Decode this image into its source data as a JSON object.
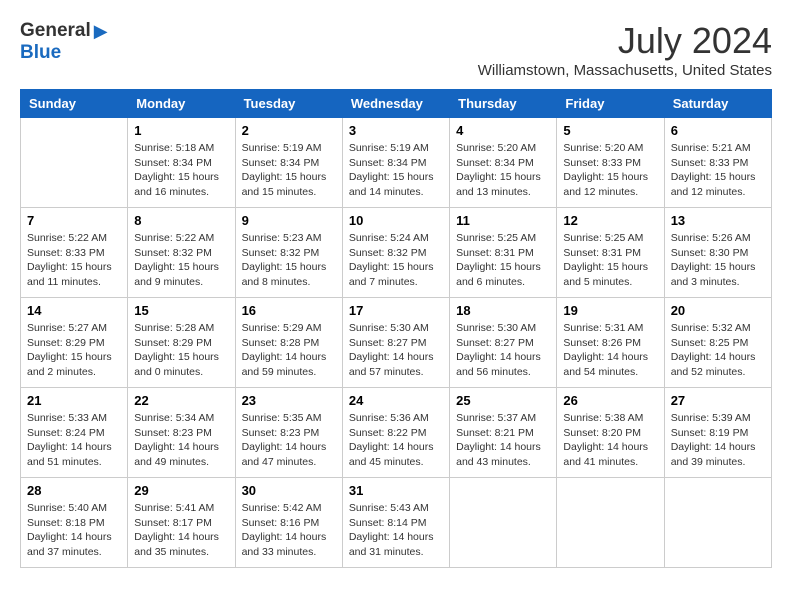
{
  "header": {
    "logo_general": "General",
    "logo_blue": "Blue",
    "month": "July 2024",
    "location": "Williamstown, Massachusetts, United States"
  },
  "days_of_week": [
    "Sunday",
    "Monday",
    "Tuesday",
    "Wednesday",
    "Thursday",
    "Friday",
    "Saturday"
  ],
  "weeks": [
    [
      {
        "day": "",
        "info": ""
      },
      {
        "day": "1",
        "info": "Sunrise: 5:18 AM\nSunset: 8:34 PM\nDaylight: 15 hours\nand 16 minutes."
      },
      {
        "day": "2",
        "info": "Sunrise: 5:19 AM\nSunset: 8:34 PM\nDaylight: 15 hours\nand 15 minutes."
      },
      {
        "day": "3",
        "info": "Sunrise: 5:19 AM\nSunset: 8:34 PM\nDaylight: 15 hours\nand 14 minutes."
      },
      {
        "day": "4",
        "info": "Sunrise: 5:20 AM\nSunset: 8:34 PM\nDaylight: 15 hours\nand 13 minutes."
      },
      {
        "day": "5",
        "info": "Sunrise: 5:20 AM\nSunset: 8:33 PM\nDaylight: 15 hours\nand 12 minutes."
      },
      {
        "day": "6",
        "info": "Sunrise: 5:21 AM\nSunset: 8:33 PM\nDaylight: 15 hours\nand 12 minutes."
      }
    ],
    [
      {
        "day": "7",
        "info": "Sunrise: 5:22 AM\nSunset: 8:33 PM\nDaylight: 15 hours\nand 11 minutes."
      },
      {
        "day": "8",
        "info": "Sunrise: 5:22 AM\nSunset: 8:32 PM\nDaylight: 15 hours\nand 9 minutes."
      },
      {
        "day": "9",
        "info": "Sunrise: 5:23 AM\nSunset: 8:32 PM\nDaylight: 15 hours\nand 8 minutes."
      },
      {
        "day": "10",
        "info": "Sunrise: 5:24 AM\nSunset: 8:32 PM\nDaylight: 15 hours\nand 7 minutes."
      },
      {
        "day": "11",
        "info": "Sunrise: 5:25 AM\nSunset: 8:31 PM\nDaylight: 15 hours\nand 6 minutes."
      },
      {
        "day": "12",
        "info": "Sunrise: 5:25 AM\nSunset: 8:31 PM\nDaylight: 15 hours\nand 5 minutes."
      },
      {
        "day": "13",
        "info": "Sunrise: 5:26 AM\nSunset: 8:30 PM\nDaylight: 15 hours\nand 3 minutes."
      }
    ],
    [
      {
        "day": "14",
        "info": "Sunrise: 5:27 AM\nSunset: 8:29 PM\nDaylight: 15 hours\nand 2 minutes."
      },
      {
        "day": "15",
        "info": "Sunrise: 5:28 AM\nSunset: 8:29 PM\nDaylight: 15 hours\nand 0 minutes."
      },
      {
        "day": "16",
        "info": "Sunrise: 5:29 AM\nSunset: 8:28 PM\nDaylight: 14 hours\nand 59 minutes."
      },
      {
        "day": "17",
        "info": "Sunrise: 5:30 AM\nSunset: 8:27 PM\nDaylight: 14 hours\nand 57 minutes."
      },
      {
        "day": "18",
        "info": "Sunrise: 5:30 AM\nSunset: 8:27 PM\nDaylight: 14 hours\nand 56 minutes."
      },
      {
        "day": "19",
        "info": "Sunrise: 5:31 AM\nSunset: 8:26 PM\nDaylight: 14 hours\nand 54 minutes."
      },
      {
        "day": "20",
        "info": "Sunrise: 5:32 AM\nSunset: 8:25 PM\nDaylight: 14 hours\nand 52 minutes."
      }
    ],
    [
      {
        "day": "21",
        "info": "Sunrise: 5:33 AM\nSunset: 8:24 PM\nDaylight: 14 hours\nand 51 minutes."
      },
      {
        "day": "22",
        "info": "Sunrise: 5:34 AM\nSunset: 8:23 PM\nDaylight: 14 hours\nand 49 minutes."
      },
      {
        "day": "23",
        "info": "Sunrise: 5:35 AM\nSunset: 8:23 PM\nDaylight: 14 hours\nand 47 minutes."
      },
      {
        "day": "24",
        "info": "Sunrise: 5:36 AM\nSunset: 8:22 PM\nDaylight: 14 hours\nand 45 minutes."
      },
      {
        "day": "25",
        "info": "Sunrise: 5:37 AM\nSunset: 8:21 PM\nDaylight: 14 hours\nand 43 minutes."
      },
      {
        "day": "26",
        "info": "Sunrise: 5:38 AM\nSunset: 8:20 PM\nDaylight: 14 hours\nand 41 minutes."
      },
      {
        "day": "27",
        "info": "Sunrise: 5:39 AM\nSunset: 8:19 PM\nDaylight: 14 hours\nand 39 minutes."
      }
    ],
    [
      {
        "day": "28",
        "info": "Sunrise: 5:40 AM\nSunset: 8:18 PM\nDaylight: 14 hours\nand 37 minutes."
      },
      {
        "day": "29",
        "info": "Sunrise: 5:41 AM\nSunset: 8:17 PM\nDaylight: 14 hours\nand 35 minutes."
      },
      {
        "day": "30",
        "info": "Sunrise: 5:42 AM\nSunset: 8:16 PM\nDaylight: 14 hours\nand 33 minutes."
      },
      {
        "day": "31",
        "info": "Sunrise: 5:43 AM\nSunset: 8:14 PM\nDaylight: 14 hours\nand 31 minutes."
      },
      {
        "day": "",
        "info": ""
      },
      {
        "day": "",
        "info": ""
      },
      {
        "day": "",
        "info": ""
      }
    ]
  ]
}
